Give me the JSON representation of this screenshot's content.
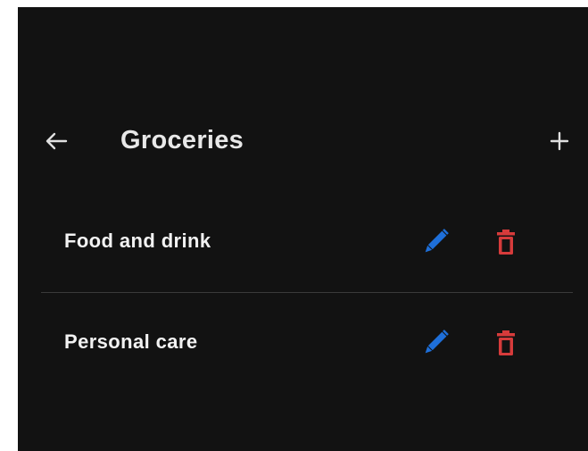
{
  "app_bar": {
    "title": "Groceries",
    "back_icon": "arrow-left-icon",
    "add_icon": "plus-icon"
  },
  "categories": [
    {
      "label": "Food and drink",
      "edit_icon": "pencil-icon",
      "delete_icon": "trash-icon"
    },
    {
      "label": "Personal care",
      "edit_icon": "pencil-icon",
      "delete_icon": "trash-icon"
    }
  ],
  "colors": {
    "background": "#121212",
    "edit": "#1e6fd9",
    "delete": "#d63b3b",
    "text": "#f2f2f2"
  }
}
